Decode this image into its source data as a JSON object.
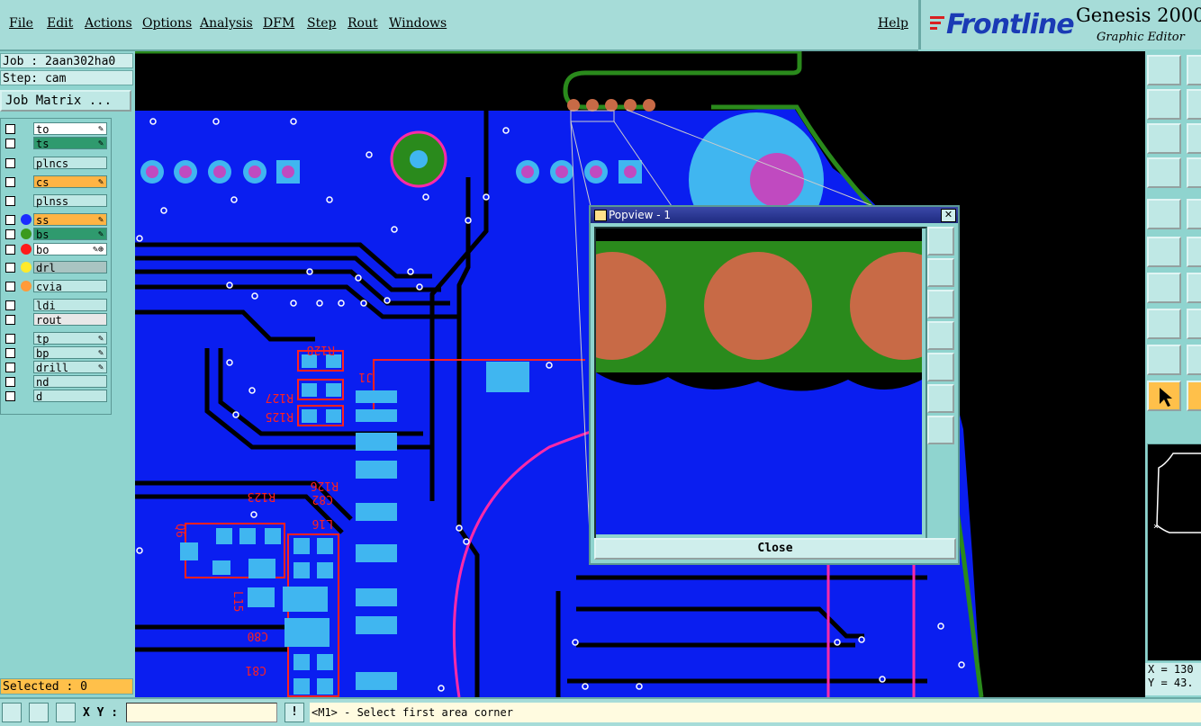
{
  "menu": {
    "items": [
      "File",
      "Edit",
      "Actions",
      "Options",
      "Analysis",
      "DFM",
      "Step",
      "Rout",
      "Windows"
    ],
    "help": "Help"
  },
  "brand": {
    "logo": "Frontline",
    "title": "Genesis 2000",
    "subtitle": "Graphic Editor"
  },
  "left_panel": {
    "job": "Job : 2aan302ha0",
    "step": "Step: cam",
    "job_matrix": "Job Matrix ...",
    "layers": [
      {
        "name": "to",
        "color": "#ffffff",
        "dot": "",
        "flag": "✎"
      },
      {
        "name": "ts",
        "color": "#2f9a6e",
        "dot": "",
        "flag": "✎"
      },
      {
        "name": "plncs",
        "color": "#bfe8e5",
        "dot": "",
        "flag": ""
      },
      {
        "name": "cs",
        "color": "#ffb444",
        "dot": "",
        "flag": "✎"
      },
      {
        "name": "plnss",
        "color": "#bfe8e5",
        "dot": "",
        "flag": ""
      },
      {
        "name": "ss",
        "color": "#ffb444",
        "dot": "#1a2cff",
        "flag": "✎"
      },
      {
        "name": "bs",
        "color": "#2f9a6e",
        "dot": "#3a9a1e",
        "flag": "✎"
      },
      {
        "name": "bo",
        "color": "#ffffff",
        "dot": "#ff1a1a",
        "flag": "✎⊕"
      },
      {
        "name": "drl",
        "color": "#a9c4c2",
        "dot": "#ffea2a",
        "flag": ""
      },
      {
        "name": "cvia",
        "color": "#bfe8e5",
        "dot": "#ff9a3a",
        "flag": ""
      },
      {
        "name": "ldi",
        "color": "#bfe8e5",
        "dot": "",
        "flag": ""
      },
      {
        "name": "rout",
        "color": "#e8e8e8",
        "dot": "",
        "flag": ""
      },
      {
        "name": "tp",
        "color": "#bfe8e5",
        "dot": "",
        "flag": "✎"
      },
      {
        "name": "bp",
        "color": "#bfe8e5",
        "dot": "",
        "flag": "✎"
      },
      {
        "name": "drill",
        "color": "#bfe8e5",
        "dot": "",
        "flag": "✎"
      },
      {
        "name": "nd",
        "color": "#bfe8e5",
        "dot": "",
        "flag": ""
      },
      {
        "name": "d",
        "color": "#bfe8e5",
        "dot": "",
        "flag": ""
      }
    ],
    "selected": "Selected : 0"
  },
  "popview": {
    "title": "Popview - 1",
    "close": "Close"
  },
  "coords": {
    "x": "X = 130",
    "y": "Y = 43."
  },
  "status": {
    "xy_label": "X Y :",
    "xy_value": "",
    "message": "<M1> - Select first area corner"
  },
  "board_labels": [
    "R128",
    "J1",
    "R127",
    "R125",
    "R126",
    "R123",
    "C82",
    "L16",
    "Q6",
    "L15",
    "C80",
    "C81"
  ],
  "colors": {
    "copper": "#0a1ef0",
    "pad": "#40b6f0",
    "via_pad": "#c04ac0",
    "silk": "#ff2020",
    "outline": "#2a8a1c",
    "copper_pad": "#c86a46",
    "rout": "#ff2aa8"
  }
}
